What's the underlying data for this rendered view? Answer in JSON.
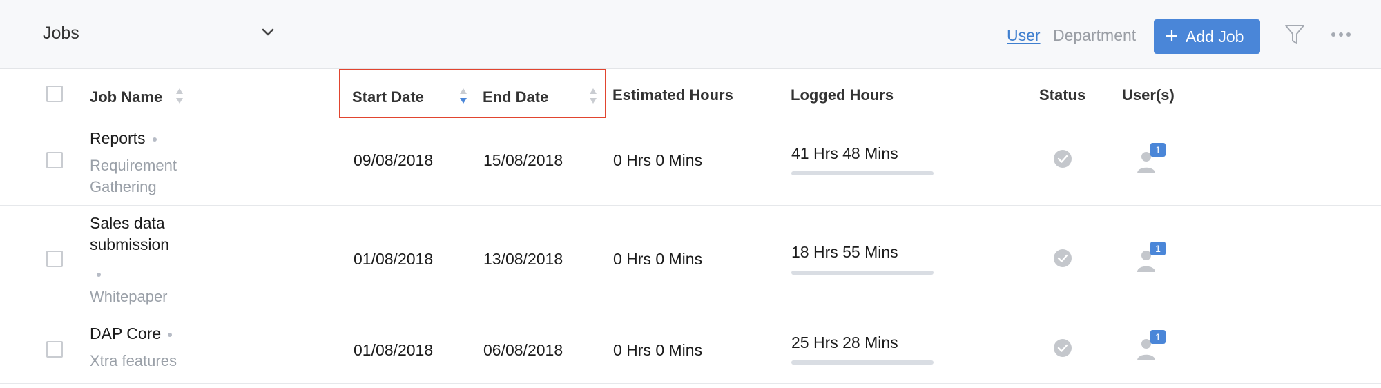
{
  "header": {
    "module_title": "Jobs",
    "view_user": "User",
    "view_department": "Department",
    "add_button": "Add Job",
    "accent_color": "#4a86d8"
  },
  "icons": {
    "chevron": "chevron-down-icon",
    "plus": "plus-icon",
    "filter": "filter-icon",
    "more": "more-horizontal-icon",
    "status": "check-circle-icon",
    "user": "user-icon"
  },
  "columns": {
    "job_name": "Job Name",
    "start_date": "Start Date",
    "end_date": "End Date",
    "estimated_hours": "Estimated Hours",
    "logged_hours": "Logged Hours",
    "status": "Status",
    "users": "User(s)"
  },
  "sort": {
    "active_column": "Start Date",
    "direction": "descending"
  },
  "rows": [
    {
      "name_lines": [
        "Reports"
      ],
      "sub_lines": [
        "Requirement",
        "Gathering"
      ],
      "start_date": "09/08/2018",
      "end_date": "15/08/2018",
      "estimated": "0 Hrs 0 Mins",
      "logged": "41 Hrs 48 Mins",
      "user_count": "1"
    },
    {
      "name_lines": [
        "Sales data",
        "submission"
      ],
      "sub_lines": [
        "Whitepaper"
      ],
      "start_date": "01/08/2018",
      "end_date": "13/08/2018",
      "estimated": "0 Hrs 0 Mins",
      "logged": "18 Hrs 55 Mins",
      "user_count": "1"
    },
    {
      "name_lines": [
        "DAP Core"
      ],
      "sub_lines": [
        "Xtra features"
      ],
      "start_date": "01/08/2018",
      "end_date": "06/08/2018",
      "estimated": "0 Hrs 0 Mins",
      "logged": "25 Hrs 28 Mins",
      "user_count": "1"
    }
  ]
}
